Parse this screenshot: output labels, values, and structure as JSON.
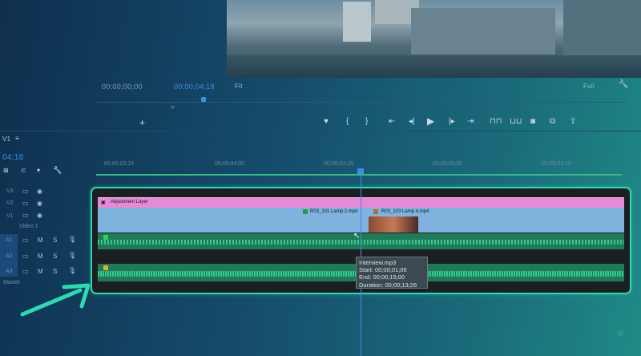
{
  "program_monitor": {
    "timecode_left": "00;00;00;00",
    "timecode_current": "00;00;04;18",
    "fit_label": "Fit",
    "zoom_label": "Full"
  },
  "timeline": {
    "target_label": "V1",
    "sequence_timecode": "04;18",
    "ruler": [
      "00;00;03;15",
      "00;00;04;00",
      "00;00;04;15",
      "00;00;05;00",
      "00;00;05;15"
    ],
    "tracks": {
      "v3": "V3",
      "v2": "V2",
      "v1": "V1",
      "video_name": "Video 1",
      "a1": "A1",
      "a2": "A2",
      "a3": "A3",
      "master": "Master",
      "m": "M",
      "s": "S"
    },
    "clips": {
      "adjustment": "Adjustment Layer",
      "clip1": "R03_101 Lamp 2.mp4",
      "clip2": "R03_103 Lamp 4.mp4"
    },
    "tooltip": {
      "name": "Interview.mp3",
      "start": "Start: 00;00;01;06",
      "end": "End: 00;00;15;00",
      "duration": "Duration: 00;00;13;26"
    }
  },
  "colors": {
    "accent": "#2fd8b0",
    "timecode_blue": "#3f8ce8",
    "adjustment": "#e58ad6",
    "video_clip": "#7fb3de",
    "audio_clip": "#1f9a6a"
  }
}
